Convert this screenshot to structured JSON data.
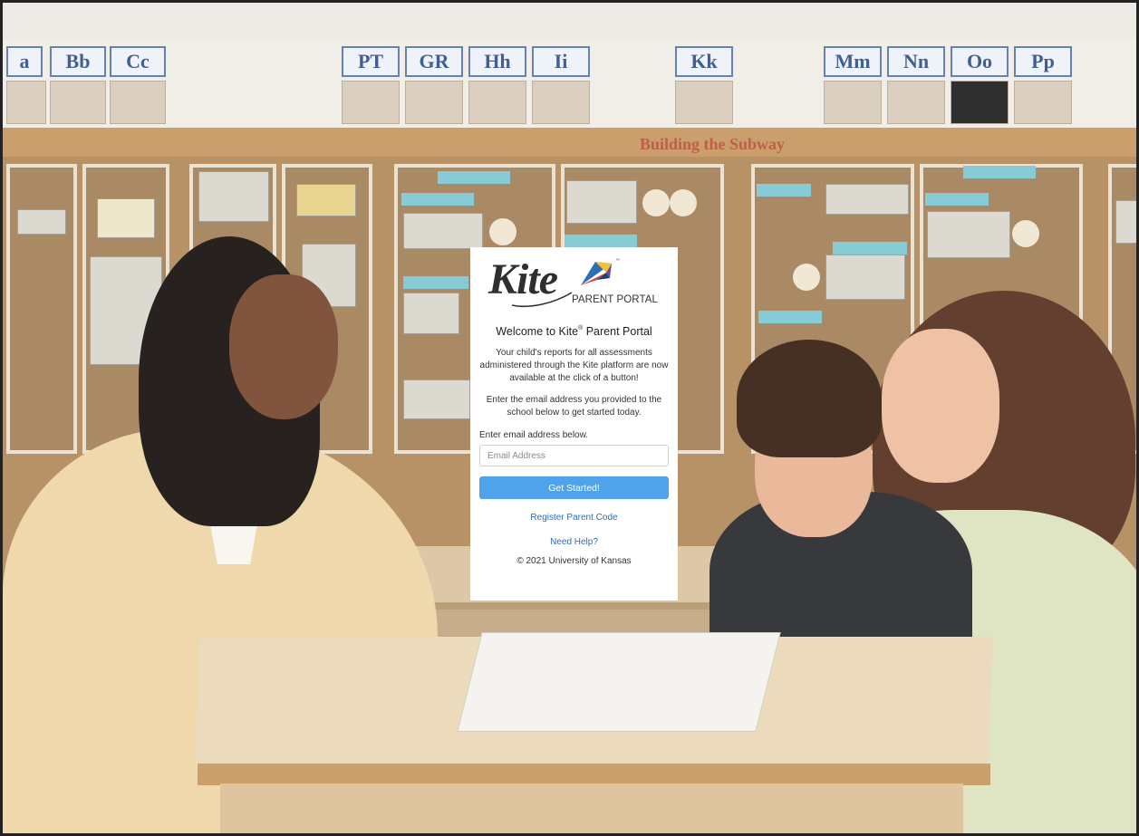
{
  "background": {
    "alphabet_cards": [
      "a",
      "Bb",
      "Cc",
      "PT",
      "GR",
      "Hh",
      "Ii",
      "Kk",
      "Mm",
      "Nn",
      "Oo",
      "Pp"
    ],
    "banner_text": "Building the Subway"
  },
  "card": {
    "logo": {
      "wordmark": "Kite",
      "trademark": "™",
      "subtitle": "PARENT PORTAL"
    },
    "welcome_prefix": "Welcome to Kite",
    "welcome_reg": "®",
    "welcome_suffix": " Parent Portal",
    "intro": "Your child's reports for all assessments administered through the Kite platform are now available at the click of a button!",
    "instructions": "Enter the email address you provided to the school below to get started today.",
    "email_label": "Enter email address below.",
    "email_placeholder": "Email Address",
    "email_value": "",
    "submit_label": "Get Started!",
    "register_link": "Register Parent Code",
    "help_link": "Need Help?",
    "copyright": "© 2021 University of Kansas"
  },
  "colors": {
    "button": "#4ea3ea",
    "link": "#2a6ebb",
    "kite_blue": "#2d6fb7",
    "kite_yellow": "#f2c230",
    "kite_red": "#d9403a",
    "kite_purple": "#6b4aa0"
  }
}
